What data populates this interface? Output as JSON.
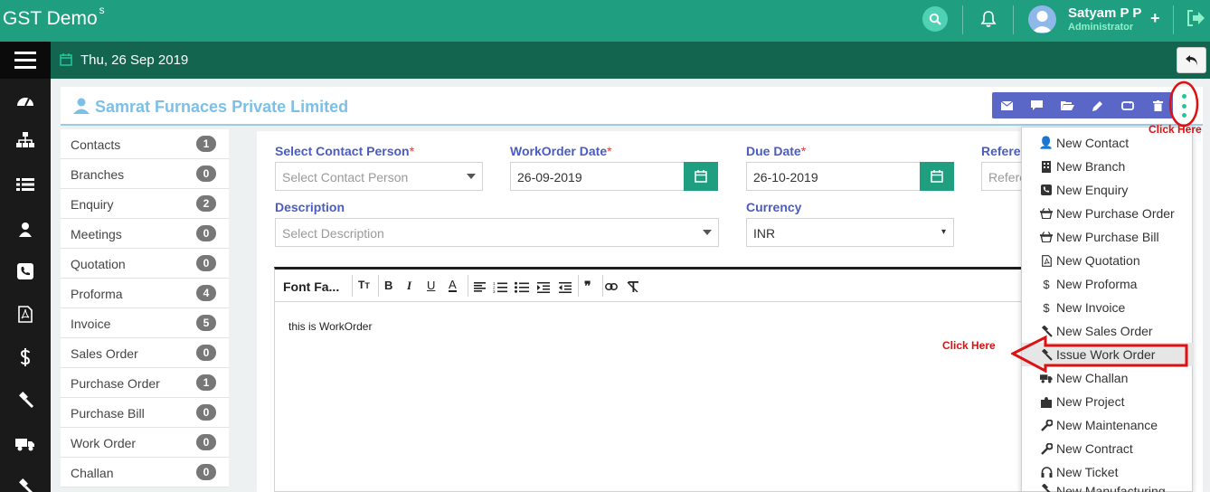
{
  "app": {
    "brand": "GST Demo",
    "brand_sup": "s"
  },
  "topbar": {
    "user_name": "Satyam P P",
    "user_role": "Administrator"
  },
  "subbar": {
    "date": "Thu, 26 Sep 2019"
  },
  "sidebar": {
    "icons": [
      "dashboard-icon",
      "sitemap-icon",
      "list-icon",
      "user-icon",
      "phone-icon",
      "pdf-icon",
      "dollar-icon",
      "gavel-icon",
      "truck-icon",
      "gavel-icon"
    ]
  },
  "header": {
    "company": "Samrat Furnaces Private Limited"
  },
  "left_list": [
    {
      "label": "Contacts",
      "count": "1"
    },
    {
      "label": "Branches",
      "count": "0"
    },
    {
      "label": "Enquiry",
      "count": "2"
    },
    {
      "label": "Meetings",
      "count": "0"
    },
    {
      "label": "Quotation",
      "count": "0"
    },
    {
      "label": "Proforma",
      "count": "4"
    },
    {
      "label": "Invoice",
      "count": "5"
    },
    {
      "label": "Sales Order",
      "count": "0"
    },
    {
      "label": "Purchase Order",
      "count": "1"
    },
    {
      "label": "Purchase Bill",
      "count": "0"
    },
    {
      "label": "Work Order",
      "count": "0"
    },
    {
      "label": "Challan",
      "count": "0"
    }
  ],
  "form": {
    "contact_label": "Select Contact Person",
    "contact_placeholder": "Select Contact Person",
    "wo_date_label": "WorkOrder Date",
    "wo_date_value": "26-09-2019",
    "due_date_label": "Due Date",
    "due_date_value": "26-10-2019",
    "reference_label": "Referer",
    "reference_placeholder": "Refere",
    "description_label": "Description",
    "description_placeholder": "Select Description",
    "currency_label": "Currency",
    "currency_value": "INR",
    "required_mark": "*"
  },
  "editor": {
    "font_family": "Font Fa...",
    "content": "this is WorkOrder",
    "tools": [
      "tt",
      "B",
      "I",
      "U",
      "A",
      "align-left",
      "ol",
      "ul",
      "indent",
      "outdent",
      "quote",
      "link",
      "clear"
    ]
  },
  "dropdown": {
    "items": [
      {
        "label": "New Contact",
        "icon": "user-icon"
      },
      {
        "label": "New Branch",
        "icon": "building-icon"
      },
      {
        "label": "New Enquiry",
        "icon": "phone-square-icon"
      },
      {
        "label": "New Purchase Order",
        "icon": "basket-icon"
      },
      {
        "label": "New Purchase Bill",
        "icon": "basket-icon"
      },
      {
        "label": "New Quotation",
        "icon": "pdf-icon"
      },
      {
        "label": "New Proforma",
        "icon": "dollar-icon"
      },
      {
        "label": "New Invoice",
        "icon": "dollar-icon"
      },
      {
        "label": "New Sales Order",
        "icon": "gavel-icon"
      },
      {
        "label": "Issue Work Order",
        "icon": "gavel-icon"
      },
      {
        "label": "New Challan",
        "icon": "truck-icon"
      },
      {
        "label": "New Project",
        "icon": "puzzle-icon"
      },
      {
        "label": "New Maintenance",
        "icon": "wrench-icon"
      },
      {
        "label": "New Contract",
        "icon": "wrench-icon"
      },
      {
        "label": "New Ticket",
        "icon": "headphones-icon"
      },
      {
        "label": "New Manufacturing",
        "icon": "gavel-icon"
      }
    ]
  },
  "annotations": {
    "click_here_top": "Click Here",
    "click_here_arrow": "Click Here"
  },
  "colors": {
    "primary": "#1f9e80",
    "dark": "#13654f",
    "accent": "#5b67c6",
    "label": "#4a5cc0",
    "annotation": "#dd1111"
  }
}
